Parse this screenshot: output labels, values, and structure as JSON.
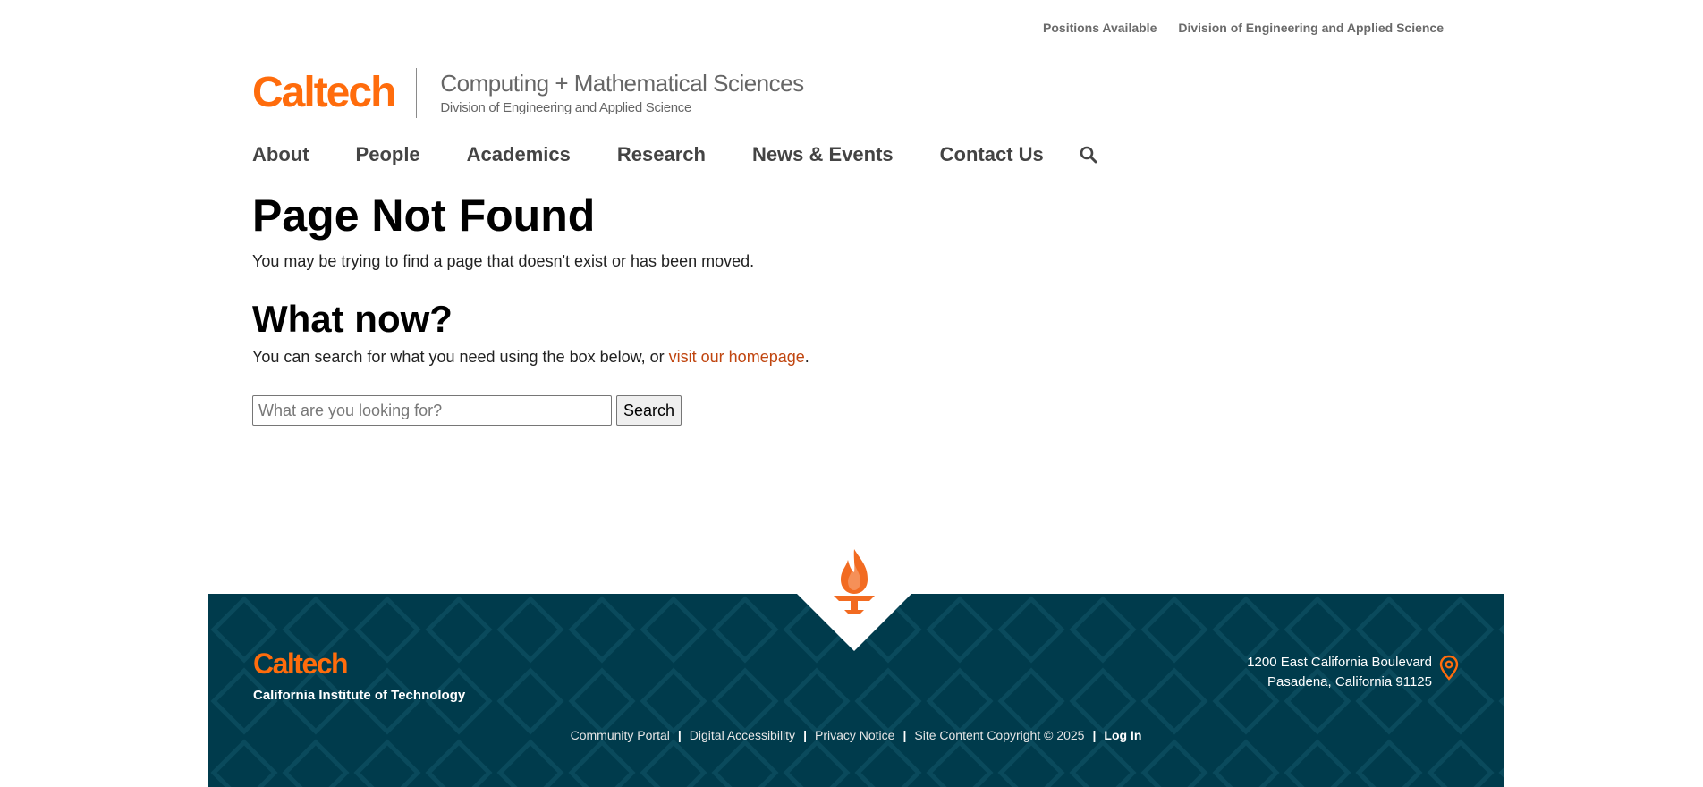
{
  "utility_nav": {
    "positions": "Positions Available",
    "division": "Division of Engineering and Applied Science"
  },
  "brand": {
    "logo_text": "Caltech",
    "site_title": "Computing + Mathematical Sciences",
    "site_subtitle": "Division of Engineering and Applied Science",
    "logo_color": "#FF6C0C"
  },
  "main_nav": {
    "items": [
      "About",
      "People",
      "Academics",
      "Research",
      "News & Events",
      "Contact Us"
    ],
    "search_icon": "search-icon"
  },
  "content": {
    "title": "Page Not Found",
    "lead": "You may be trying to find a page that doesn't exist or has been moved.",
    "subheading": "What now?",
    "body_prefix": "You can search for what you need using the box below, or ",
    "homepage_link": "visit our homepage",
    "body_suffix": ".",
    "search_placeholder": "What are you looking for?",
    "search_button": "Search",
    "link_color": "#C0450F"
  },
  "footer": {
    "logo_text": "Caltech",
    "tagline": "California Institute of Technology",
    "address_line1": "1200 East California Boulevard",
    "address_line2": "Pasadena, California 91125",
    "links": [
      "Community Portal",
      "Digital Accessibility",
      "Privacy Notice",
      "Site Content Copyright © 2025"
    ],
    "login": "Log In",
    "background_color": "#003B4C",
    "icons": [
      "flame-icon",
      "location-pin-icon"
    ]
  }
}
